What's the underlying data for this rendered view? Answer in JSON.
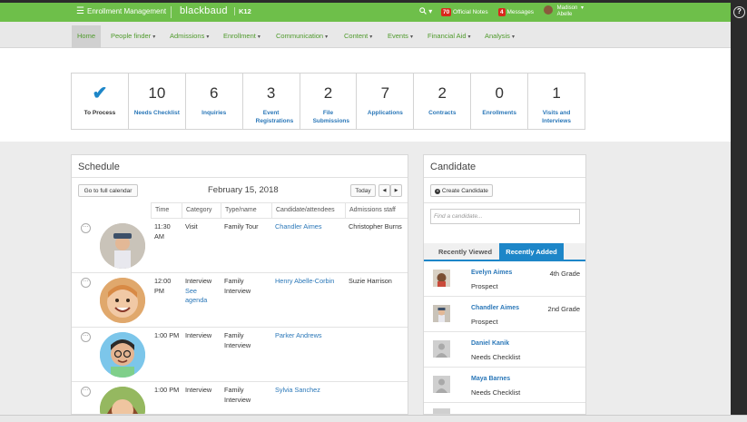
{
  "topbar": {
    "menu_icon": "hamburger-icon",
    "app_name": "Enrollment Management",
    "logo": "blackbaud",
    "product": "K12",
    "search_icon": "search-icon",
    "search_caret": "▾",
    "notes_count": "70",
    "notes_label": "Official Notes",
    "messages_count": "4",
    "messages_label": "Messages",
    "user_first": "Madison",
    "user_last": "Abelle",
    "user_caret": "▾"
  },
  "nav": {
    "items": [
      {
        "label": "Home",
        "caret": ""
      },
      {
        "label": "People finder",
        "caret": "▾"
      },
      {
        "label": "Admissions",
        "caret": "▾"
      },
      {
        "label": "Enrollment",
        "caret": "▾"
      },
      {
        "label": "Communication",
        "caret": "▾"
      },
      {
        "label": "Content",
        "caret": "▾"
      },
      {
        "label": "Events",
        "caret": "▾"
      },
      {
        "label": "Financial Aid",
        "caret": "▾"
      },
      {
        "label": "Analysis",
        "caret": "▾"
      }
    ]
  },
  "stats": [
    {
      "value": "",
      "icon": "checkmark-icon",
      "label": "To Process"
    },
    {
      "value": "10",
      "label": "Needs Checklist"
    },
    {
      "value": "6",
      "label": "Inquiries"
    },
    {
      "value": "3",
      "label": "Event Registrations"
    },
    {
      "value": "2",
      "label": "File Submissions"
    },
    {
      "value": "7",
      "label": "Applications"
    },
    {
      "value": "2",
      "label": "Contracts"
    },
    {
      "value": "0",
      "label": "Enrollments"
    },
    {
      "value": "1",
      "label": "Visits and Interviews"
    }
  ],
  "schedule": {
    "title": "Schedule",
    "full_calendar_button": "Go to full calendar",
    "date": "February 15, 2018",
    "today_button": "Today",
    "prev_icon": "◀",
    "next_icon": "▶",
    "columns": [
      "Time",
      "Category",
      "Type/name",
      "Candidate/attendees",
      "Admissions staff"
    ],
    "rows": [
      {
        "time": "11:30 AM",
        "category": "Visit",
        "category_link": "",
        "type": "Family Tour",
        "candidate": "Chandler Aimes",
        "staff": "Christopher Burns",
        "photo": "boy-with-hat"
      },
      {
        "time": "12:00 PM",
        "category": "Interview",
        "category_link": "See agenda",
        "type": "Family Interview",
        "candidate": "Henry Abelle-Corbin",
        "staff": "Suzie Harrison",
        "photo": "smiling-boy"
      },
      {
        "time": "1:00 PM",
        "category": "Interview",
        "category_link": "",
        "type": "Family Interview",
        "candidate": "Parker Andrews",
        "staff": "",
        "photo": "boy-with-glasses"
      },
      {
        "time": "1:00 PM",
        "category": "Interview",
        "category_link": "",
        "type": "Family Interview",
        "candidate": "Sylvia Sanchez",
        "staff": "",
        "photo": "girl"
      }
    ]
  },
  "candidate": {
    "title": "Candidate",
    "create_button": "Create Candidate",
    "create_icon": "plus-circle-icon",
    "find_placeholder": "Find a candidate...",
    "tab_recent_viewed": "Recently Viewed",
    "tab_recent_added": "Recently Added",
    "list": [
      {
        "name": "Evelyn Aimes",
        "status": "Prospect",
        "grade": "4th Grade",
        "photo": "photo"
      },
      {
        "name": "Chandler Aimes",
        "status": "Prospect",
        "grade": "2nd Grade",
        "photo": "photo"
      },
      {
        "name": "Daniel Kanik",
        "status": "Needs Checklist",
        "grade": "",
        "photo": "placeholder"
      },
      {
        "name": "Maya Barnes",
        "status": "Needs Checklist",
        "grade": "",
        "photo": "placeholder"
      }
    ]
  },
  "colors": {
    "topbar_green": "#6ebf4a",
    "link_blue": "#2a77b8",
    "accent_blue": "#1d86c8",
    "badge_red": "#d9281c"
  }
}
